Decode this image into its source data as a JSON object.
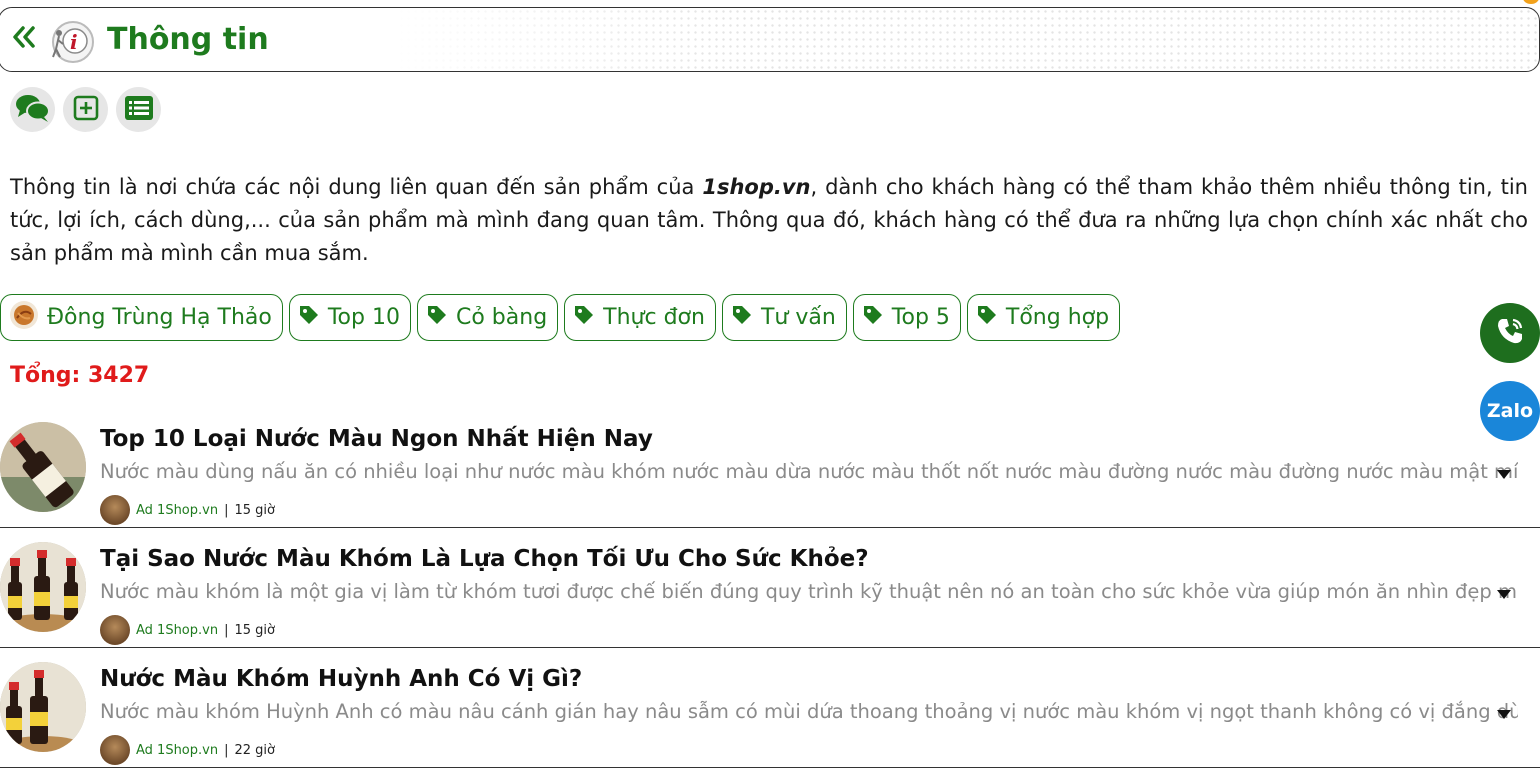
{
  "header": {
    "title": "Thông tin",
    "back_icon": "double-chevron-left-icon",
    "logo_icon": "info-logo-icon"
  },
  "toolbar": {
    "buttons": [
      {
        "icon": "comments-icon"
      },
      {
        "icon": "plus-square-icon"
      },
      {
        "icon": "list-icon"
      }
    ]
  },
  "intro": {
    "before": "Thông tin là nơi chứa các nội dung liên quan đến sản phẩm của ",
    "brand": "1shop.vn",
    "after": ", dành cho khách hàng có thể tham khảo thêm nhiều thông tin, tin tức, lợi ích, cách dùng,... của sản phẩm mà mình đang quan tâm. Thông qua đó, khách hàng có thể đưa ra những lựa chọn chính xác nhất cho sản phẩm mà mình cần mua sắm."
  },
  "tags": [
    {
      "label": "Đông Trùng Hạ Thảo",
      "icon": "product-thumb-icon"
    },
    {
      "label": "Top 10",
      "icon": "tag-icon"
    },
    {
      "label": "Cỏ bàng",
      "icon": "tag-icon"
    },
    {
      "label": "Thực đơn",
      "icon": "tag-icon"
    },
    {
      "label": "Tư vấn",
      "icon": "tag-icon"
    },
    {
      "label": "Top 5",
      "icon": "tag-icon"
    },
    {
      "label": "Tổng hợp",
      "icon": "tag-icon"
    }
  ],
  "total": "Tổng: 3427",
  "articles": [
    {
      "title": "Top 10 Loại Nước Màu Ngon Nhất Hiện Nay",
      "excerpt": "Nước màu dùng nấu ăn có nhiều loại như nước màu khóm nước màu dừa nước màu thốt nốt nước màu đường nước màu đường nước màu mật mía mỗi loại đều có",
      "author": "Ad 1Shop.vn",
      "separator": "|",
      "time": "15 giờ"
    },
    {
      "title": "Tại Sao Nước Màu Khóm Là Lựa Chọn Tối Ưu Cho Sức Khỏe?",
      "excerpt": "Nước màu khóm là một gia vị làm từ khóm tươi được chế biến đúng quy trình kỹ thuật nên nó an toàn cho sức khỏe vừa giúp món ăn nhìn đẹp mắt và thơm ngon",
      "author": "Ad 1Shop.vn",
      "separator": "|",
      "time": "15 giờ"
    },
    {
      "title": "Nước Màu Khóm Huỳnh Anh Có Vị Gì?",
      "excerpt": "Nước màu khóm Huỳnh Anh có màu nâu cánh gián hay nâu sẫm có mùi dứa thoang thoảng vị nước màu khóm vị ngọt thanh không có vị đắng dùng để tẩm ướp",
      "author": "Ad 1Shop.vn",
      "separator": "|",
      "time": "22 giờ"
    }
  ],
  "floating": {
    "call_icon": "phone-call-icon",
    "zalo_label": "Zalo"
  },
  "colors": {
    "brand_green": "#1e7b1e",
    "total_red": "#e01b1b",
    "zalo_blue": "#1a86d9"
  }
}
